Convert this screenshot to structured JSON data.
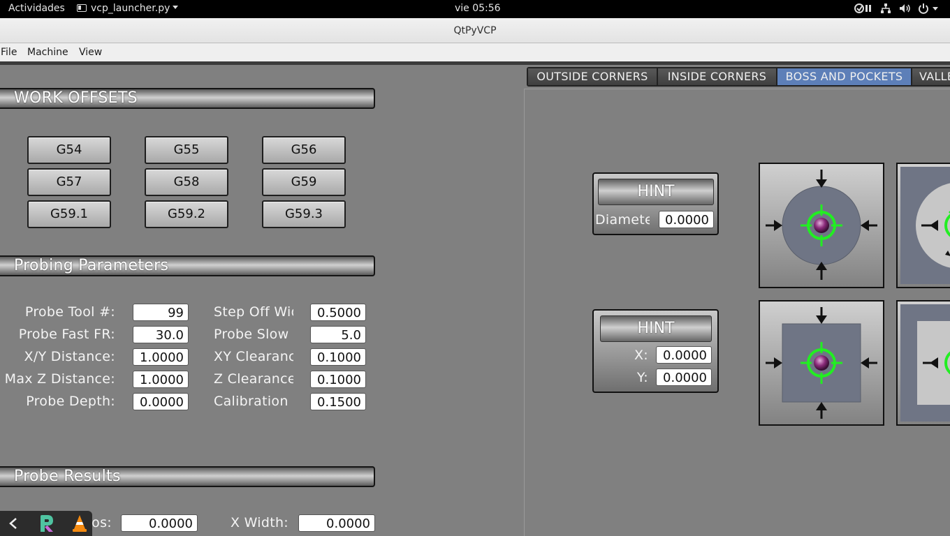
{
  "topbar": {
    "activities": "Actividades",
    "app_name": "vcp_launcher.py",
    "clock": "vie 05:56"
  },
  "window": {
    "title": "QtPyVCP"
  },
  "menubar": {
    "items": [
      "File",
      "Machine",
      "View"
    ]
  },
  "work_offsets": {
    "header": "WORK OFFSETS",
    "buttons": [
      "G54",
      "G55",
      "G56",
      "G57",
      "G58",
      "G59",
      "G59.1",
      "G59.2",
      "G59.3"
    ]
  },
  "probing_parameters": {
    "header": "Probing Parameters",
    "left": [
      {
        "label": "Probe Tool #:",
        "value": "99"
      },
      {
        "label": "Probe Fast FR:",
        "value": "30.0"
      },
      {
        "label": "X/Y Distance:",
        "value": "1.0000"
      },
      {
        "label": "Max Z Distance:",
        "value": "1.0000"
      },
      {
        "label": "Probe Depth:",
        "value": "0.0000"
      }
    ],
    "right": [
      {
        "label": "Step Off Width:",
        "value": "0.5000"
      },
      {
        "label": "Probe Slow FR:",
        "value": "5.0"
      },
      {
        "label": "XY Clearance:",
        "value": "0.1000"
      },
      {
        "label": "Z Clearance:",
        "value": "0.1000"
      },
      {
        "label": "Calibration Dia:",
        "value": "0.1500"
      }
    ]
  },
  "probe_results": {
    "header": "Probe Results",
    "fields": [
      {
        "label": "X Pos:",
        "value": "0.0000"
      },
      {
        "label": "X Width:",
        "value": "0.0000"
      }
    ]
  },
  "tabs": {
    "items": [
      "OUTSIDE CORNERS",
      "INSIDE CORNERS",
      "BOSS AND POCKETS",
      "VALLEY"
    ],
    "active": "BOSS AND POCKETS"
  },
  "hint_panels": [
    {
      "button": "HINT",
      "fields": [
        {
          "label": "Diameter:",
          "value": "0.0000"
        }
      ]
    },
    {
      "button": "HINT",
      "fields": [
        {
          "label": "X:",
          "value": "0.0000"
        },
        {
          "label": "Y:",
          "value": "0.0000"
        }
      ]
    }
  ],
  "icons": {
    "app_menu": "window-icon",
    "tray": [
      "accessibility-icon",
      "network-icon",
      "volume-icon",
      "power-icon"
    ],
    "dock": [
      "back-chevron-icon",
      "pycharm-icon",
      "vlc-icon"
    ],
    "tiles": [
      "boss-probe-icon",
      "pocket-probe-icon",
      "rect-boss-probe-icon",
      "rect-pocket-probe-icon"
    ]
  },
  "colors": {
    "active_tab": "#5d7fb8",
    "background": "#808080",
    "target_green": "#22ee22",
    "probe_ball": "#8a2a7a"
  }
}
